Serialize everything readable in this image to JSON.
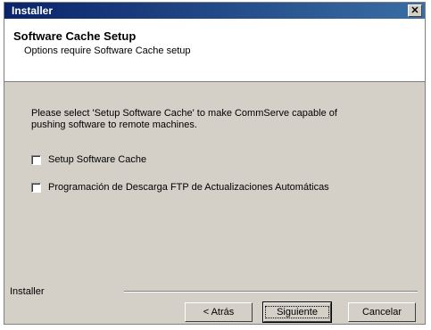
{
  "window": {
    "title": "Installer",
    "close_glyph": "✕"
  },
  "header": {
    "title": "Software Cache Setup",
    "subtitle": "Options require Software Cache setup"
  },
  "body": {
    "description": "Please select 'Setup Software Cache' to make CommServe capable of pushing software to remote machines.",
    "checkboxes": [
      {
        "label": "Setup Software Cache",
        "checked": false
      },
      {
        "label": "Programación de Descarga FTP de Actualizaciones Automáticas",
        "checked": false
      }
    ]
  },
  "footer": {
    "label": "Installer",
    "buttons": {
      "back": "< Atrás",
      "next": "Siguiente",
      "cancel": "Cancelar"
    }
  }
}
